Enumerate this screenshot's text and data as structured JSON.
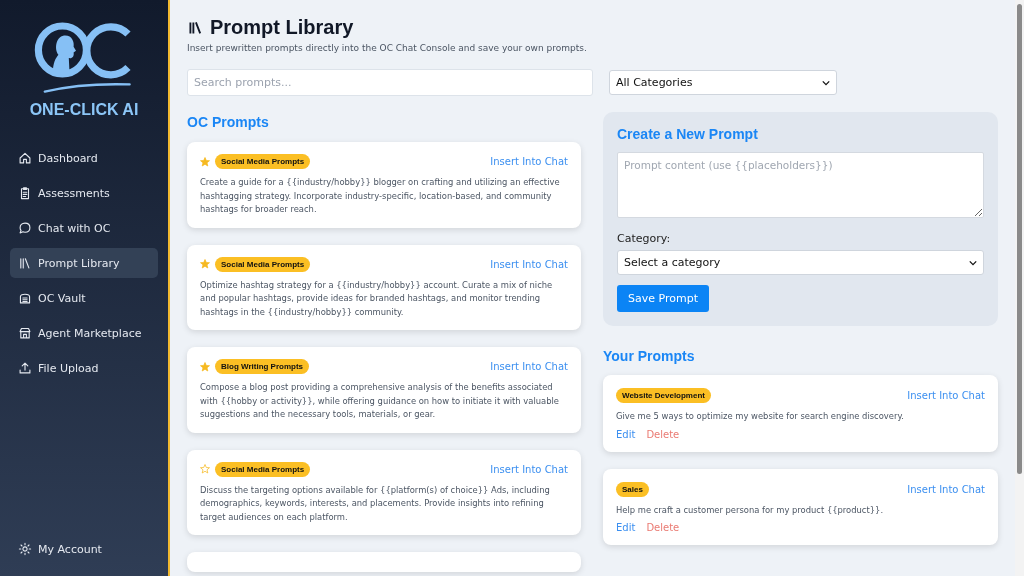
{
  "sidebar": {
    "logo_text": "ONE-CLICK AI",
    "items": [
      {
        "label": "Dashboard",
        "selected": false
      },
      {
        "label": "Assessments",
        "selected": false
      },
      {
        "label": "Chat with OC",
        "selected": false
      },
      {
        "label": "Prompt Library",
        "selected": true
      },
      {
        "label": "OC Vault",
        "selected": false
      },
      {
        "label": "Agent Marketplace",
        "selected": false
      },
      {
        "label": "File Upload",
        "selected": false
      }
    ],
    "footer_item": {
      "label": "My Account"
    }
  },
  "header": {
    "title": "Prompt Library",
    "subtitle": "Insert prewritten prompts directly into the OC Chat Console and save your own prompts."
  },
  "search": {
    "placeholder": "Search prompts..."
  },
  "category_filter": {
    "value": "All Categories"
  },
  "oc_prompts": {
    "heading": "OC Prompts",
    "items": [
      {
        "category": "Social Media Prompts",
        "favorite": true,
        "action": "Insert Into Chat",
        "text": "Create a guide for a {{industry/hobby}} blogger on crafting and utilizing an effective hashtagging strategy. Incorporate industry-specific, location-based, and community hashtags for broader reach."
      },
      {
        "category": "Social Media Prompts",
        "favorite": true,
        "action": "Insert Into Chat",
        "text": "Optimize hashtag strategy for a {{industry/hobby}} account. Curate a mix of niche and popular hashtags, provide ideas for branded hashtags, and monitor trending hashtags in the {{industry/hobby}} community."
      },
      {
        "category": "Blog Writing Prompts",
        "favorite": true,
        "action": "Insert Into Chat",
        "text": "Compose a blog post providing a comprehensive analysis of the benefits associated with {{hobby or activity}}, while offering guidance on how to initiate it with valuable suggestions and the necessary tools, materials, or gear."
      },
      {
        "category": "Social Media Prompts",
        "favorite": false,
        "action": "Insert Into Chat",
        "text": "Discuss the targeting options available for {{platform(s) of choice}} Ads, including demographics, keywords, interests, and placements. Provide insights into refining target audiences on each platform."
      }
    ]
  },
  "create_form": {
    "heading": "Create a New Prompt",
    "content_placeholder": "Prompt content (use {{placeholders}})",
    "category_label": "Category:",
    "category_value": "Select a category",
    "save_button": "Save Prompt"
  },
  "your_prompts": {
    "heading": "Your Prompts",
    "items": [
      {
        "category": "Website Development",
        "action": "Insert Into Chat",
        "text": "Give me 5 ways to optimize my website for search engine discovery.",
        "edit": "Edit",
        "delete": "Delete"
      },
      {
        "category": "Sales",
        "action": "Insert Into Chat",
        "text": "Help me craft a customer persona for my product {{product}}.",
        "edit": "Edit",
        "delete": "Delete"
      }
    ]
  }
}
